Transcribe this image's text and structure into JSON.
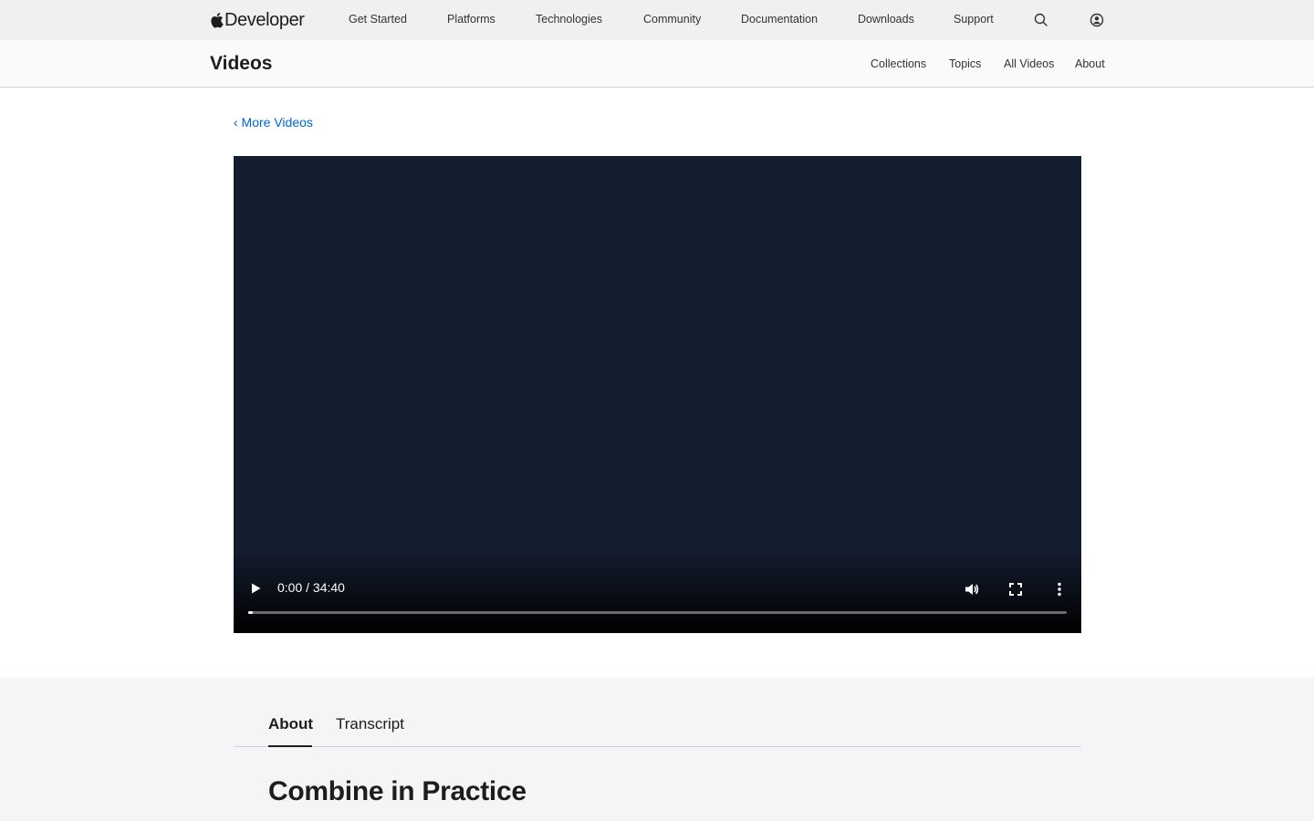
{
  "globalnav": {
    "brand_text": "Developer",
    "items": [
      {
        "label": "Get Started"
      },
      {
        "label": "Platforms"
      },
      {
        "label": "Technologies"
      },
      {
        "label": "Community"
      },
      {
        "label": "Documentation"
      },
      {
        "label": "Downloads"
      },
      {
        "label": "Support"
      }
    ],
    "icons": [
      "apple-logo-icon",
      "search-icon",
      "account-icon"
    ]
  },
  "localnav": {
    "title": "Videos",
    "links": [
      {
        "label": "Collections"
      },
      {
        "label": "Topics"
      },
      {
        "label": "All Videos"
      },
      {
        "label": "About"
      }
    ]
  },
  "back_link": "‹ More Videos",
  "player": {
    "time_display": "0:00 / 34:40",
    "progress": 0,
    "icons": [
      "play-icon",
      "volume-icon",
      "fullscreen-icon",
      "more-options-icon"
    ]
  },
  "details": {
    "tabs": [
      {
        "label": "About",
        "active": true
      },
      {
        "label": "Transcript",
        "active": false
      }
    ],
    "title": "Combine in Practice"
  },
  "colors": {
    "link": "#0066cc",
    "player_bg": "#141c2f",
    "section_bg": "#f5f5f7"
  }
}
